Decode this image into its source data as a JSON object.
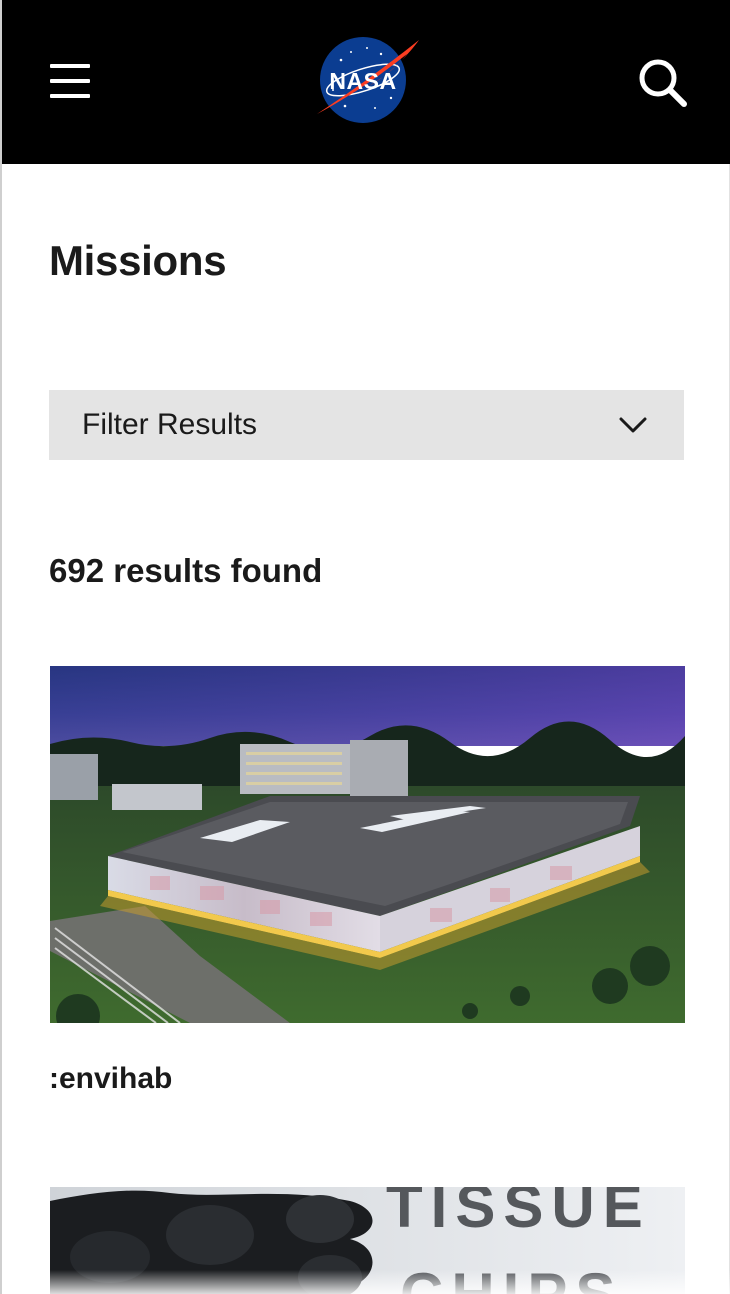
{
  "header": {
    "logo_text": "NASA",
    "menu_icon": "hamburger-menu-icon",
    "search_icon": "search-icon",
    "background": "#000000",
    "logo_blue": "#0b3d91",
    "logo_red": "#fc3d21"
  },
  "main": {
    "title": "Missions",
    "filter": {
      "label": "Filter Results",
      "icon": "chevron-down-icon"
    },
    "results_count": "692 results found",
    "cards": [
      {
        "title": ":envihab",
        "image_alt": "Aerial night view of the :envihab research facility"
      },
      {
        "title": "",
        "image_text_line1": "TISSUE",
        "image_text_line2": "CHIPS"
      }
    ]
  }
}
